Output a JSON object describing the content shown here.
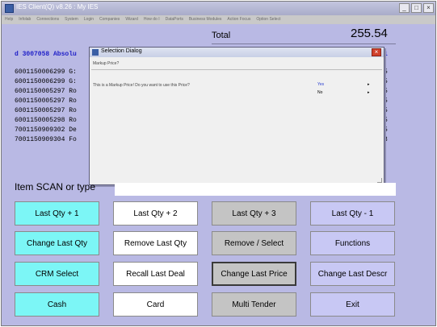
{
  "window": {
    "title": "IES Client(Q) v8.26 : My IES",
    "min_label": "_",
    "max_label": "□",
    "close_label": "×"
  },
  "menu": [
    "Help",
    "Infolab",
    "Connections",
    "System",
    "Login",
    "Companies",
    "Wizard",
    "How do I",
    "DataPorts",
    "Business Modules",
    "Action Focus",
    "Option Select"
  ],
  "total": {
    "label": "Total",
    "value": "255.54"
  },
  "deal": {
    "header": "d 3007058 Absolu",
    "header_right": "1",
    "lines": [
      {
        "code": "6001150006299 G:",
        "qty": "5"
      },
      {
        "code": "6001150006299 G:",
        "qty": "5"
      },
      {
        "code": "6001150005297 Ro",
        "qty": "5"
      },
      {
        "code": "6001150005297 Ro",
        "qty": "5"
      },
      {
        "code": "6001150005297 Ro",
        "qty": "5"
      },
      {
        "code": "6001150005298 Ro",
        "qty": "5"
      },
      {
        "code": "7001150909302 De",
        "qty": "5"
      },
      {
        "code": "7001150909304 Fo",
        "qty": "3"
      }
    ]
  },
  "dialog": {
    "title": "Selection Dialog",
    "close_label": "×",
    "subtitle": "Markup Price?",
    "question": "This is a Markup Price! Do you want to use this Price?",
    "options": [
      {
        "label": "Yes",
        "arrow": "▸",
        "color": "#2a3fd0"
      },
      {
        "label": "No",
        "arrow": "▸",
        "color": "#000000"
      }
    ]
  },
  "scan": {
    "label": "Item SCAN or type",
    "value": ""
  },
  "buttons": [
    {
      "label": "Last Qty + 1",
      "style": "cyan"
    },
    {
      "label": "Last Qty + 2",
      "style": "white"
    },
    {
      "label": "Last Qty + 3",
      "style": "gray"
    },
    {
      "label": "Last Qty - 1",
      "style": "lav"
    },
    {
      "label": "Change Last Qty",
      "style": "cyan"
    },
    {
      "label": "Remove Last Qty",
      "style": "white"
    },
    {
      "label": "Remove / Select",
      "style": "gray"
    },
    {
      "label": "Functions",
      "style": "lav"
    },
    {
      "label": "CRM Select",
      "style": "cyan"
    },
    {
      "label": "Recall Last Deal",
      "style": "white"
    },
    {
      "label": "Change Last Price",
      "style": "gray",
      "selected": true
    },
    {
      "label": "Change Last Descr",
      "style": "lav"
    },
    {
      "label": "Cash",
      "style": "cyan"
    },
    {
      "label": "Card",
      "style": "white"
    },
    {
      "label": "Multi Tender",
      "style": "gray"
    },
    {
      "label": "Exit",
      "style": "lav"
    }
  ]
}
